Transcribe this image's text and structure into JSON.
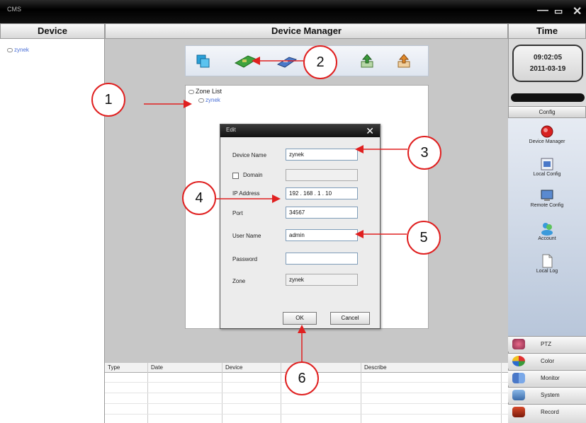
{
  "titlebar": {
    "app_title": "CMS",
    "minimize": "—",
    "restore": "▭",
    "close": "✕"
  },
  "headers": {
    "device": "Device",
    "device_manager": "Device Manager",
    "time": "Time"
  },
  "device_tree": {
    "items": [
      "zynek"
    ]
  },
  "toolbar": {
    "icons": [
      "add-zone-icon",
      "add-device-icon",
      "modify-device-icon",
      "import-icon",
      "export-icon"
    ]
  },
  "zone_list": {
    "label": "Zone List",
    "child": "zynek"
  },
  "edit_dialog": {
    "title": "Edit",
    "close": "✕",
    "device_name_label": "Device Name",
    "device_name_value": "zynek",
    "domain_label": "Domain",
    "domain_value": "",
    "ip_label": "IP Address",
    "ip_value": "192 . 168 . 1 . 10",
    "port_label": "Port",
    "port_value": "34567",
    "user_label": "User Name",
    "user_value": "admin",
    "password_label": "Password",
    "password_value": "",
    "zone_label": "Zone",
    "zone_value": "zynek",
    "ok_label": "OK",
    "cancel_label": "Cancel"
  },
  "log_table": {
    "columns": [
      "Type",
      "Date",
      "Device",
      "",
      "Describe"
    ]
  },
  "clock": {
    "time": "09:02:05",
    "date": "2011-03-19"
  },
  "config": {
    "header": "Config",
    "items": [
      "Device Manager",
      "Local Config",
      "Remote Config",
      "Account",
      "Local Log"
    ]
  },
  "menu": {
    "items": [
      "PTZ",
      "Color",
      "Monitor",
      "System",
      "Record"
    ]
  },
  "callouts": [
    "1",
    "2",
    "3",
    "4",
    "5",
    "6"
  ],
  "colors": {
    "callout_red": "#e02020",
    "link_blue": "#4a6fd6"
  }
}
